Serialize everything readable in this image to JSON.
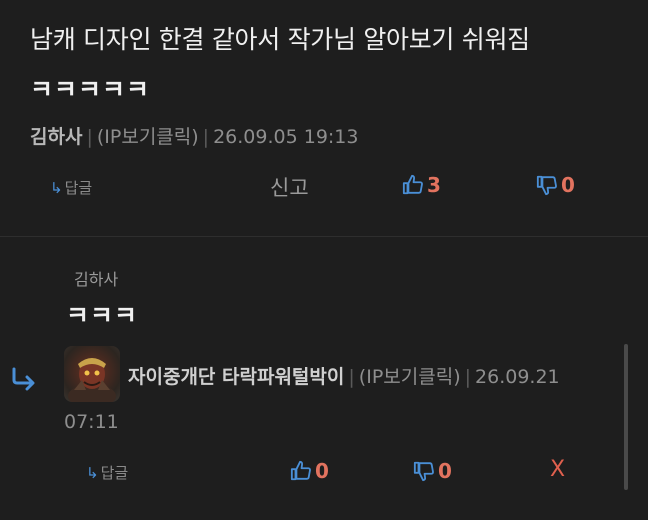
{
  "comment1": {
    "body_line1": "남캐 디자인 한결 같아서 작가님 알아보기 쉬워짐",
    "body_line2": "ㅋㅋㅋㅋㅋ",
    "author": "김하사",
    "ip": "(IP보기클릭)",
    "datetime": "26.09.05 19:13",
    "reply_label": "답글",
    "report_label": "신고",
    "likes": "3",
    "dislikes": "0"
  },
  "reply": {
    "reply_to": "김하사",
    "body": "ㅋㅋㅋ",
    "author": "자이중개단 타락파워털박이",
    "ip": "(IP보기클릭)",
    "date": "26.09.21",
    "time": "07:11",
    "reply_label": "답글",
    "likes": "0",
    "dislikes": "0",
    "delete_label": "X"
  },
  "colors": {
    "background": "#1e1e1e",
    "accent_count": "#e2735f",
    "link_blue": "#4a8fd6",
    "thumb_icon": "#4a8fd6"
  },
  "icons": [
    "reply-arrow-icon",
    "thumbs-up-icon",
    "thumbs-down-icon",
    "avatar-image"
  ]
}
